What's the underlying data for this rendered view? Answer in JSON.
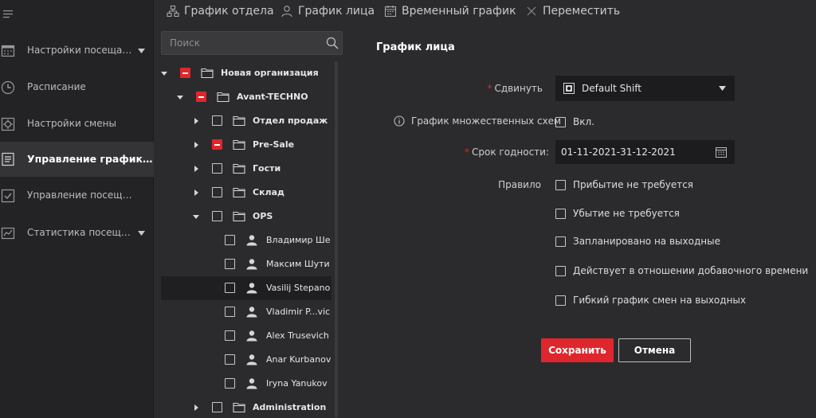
{
  "colors": {
    "accent": "#e0262d",
    "background": "#2b2b2d",
    "sidebar": "#232325"
  },
  "sidebar": {
    "items": [
      {
        "label": "Настройки посещае...",
        "icon": "attendance-settings-icon",
        "has_caret": true
      },
      {
        "label": "Расписание",
        "icon": "clock-icon",
        "has_caret": false
      },
      {
        "label": "Настройки смены",
        "icon": "shift-settings-icon",
        "has_caret": false
      },
      {
        "label": "Управление графиком с...",
        "icon": "schedule-management-icon",
        "has_caret": false,
        "active": true
      },
      {
        "label": "Управление посещаемос...",
        "icon": "attendance-management-icon",
        "has_caret": false
      },
      {
        "label": "Статистика посещен...",
        "icon": "statistics-icon",
        "has_caret": true
      }
    ]
  },
  "toolbar": {
    "department_schedule": "График отдела",
    "person_schedule": "График лица",
    "temporary_schedule": "Временный график",
    "move": "Переместить"
  },
  "search": {
    "placeholder": "Поиск"
  },
  "tree": [
    {
      "label": "Новая организация",
      "level": 0,
      "expanded": true,
      "check": "partial",
      "type": "folder",
      "bold": true
    },
    {
      "label": "Avant-TECHNO",
      "level": 1,
      "expanded": true,
      "check": "partial",
      "type": "folder",
      "bold": true
    },
    {
      "label": "Отдел продаж",
      "level": 2,
      "expanded": false,
      "check": "none",
      "type": "folder",
      "bold": true
    },
    {
      "label": "Pre-Sale",
      "level": 2,
      "expanded": false,
      "check": "partial",
      "type": "folder",
      "bold": true
    },
    {
      "label": "Гости",
      "level": 2,
      "expanded": false,
      "check": "none",
      "type": "folder",
      "bold": true
    },
    {
      "label": "Склад",
      "level": 2,
      "expanded": false,
      "check": "none",
      "type": "folder",
      "bold": true
    },
    {
      "label": "OPS",
      "level": 2,
      "expanded": true,
      "check": "none",
      "type": "folder",
      "bold": true
    },
    {
      "label": "Владимир Ше",
      "level": 3,
      "check": "none",
      "type": "person"
    },
    {
      "label": "Максим Шути",
      "level": 3,
      "check": "none",
      "type": "person"
    },
    {
      "label": "Vasilij Stepano",
      "level": 3,
      "check": "none",
      "type": "person",
      "selected": true
    },
    {
      "label": "Vladimir P...vic",
      "level": 3,
      "check": "none",
      "type": "person"
    },
    {
      "label": "Alex Trusevich",
      "level": 3,
      "check": "none",
      "type": "person"
    },
    {
      "label": "Anar Kurbanov",
      "level": 3,
      "check": "none",
      "type": "person"
    },
    {
      "label": "Iryna Yanukov",
      "level": 3,
      "check": "none",
      "type": "person"
    },
    {
      "label": "Administration",
      "level": 2,
      "expanded": false,
      "check": "none",
      "type": "folder",
      "bold": true
    }
  ],
  "form": {
    "title": "График лица",
    "shift_label": "Сдвинуть",
    "shift_value": "Default Shift",
    "multi_schedule_label": "График множественных схем",
    "multi_schedule_checkbox": "Вкл.",
    "validity_label": "Срок годности:",
    "validity_value": "01-11-2021-31-12-2021",
    "rule_label": "Правило",
    "rules": [
      "Прибытие не требуется",
      "Убытие не требуется",
      "Запланировано на выходные",
      "Действует в отношении добавочного времени",
      "Гибкий график смен на выходных"
    ],
    "required_mark": "*",
    "save": "Сохранить",
    "cancel": "Отмена"
  }
}
